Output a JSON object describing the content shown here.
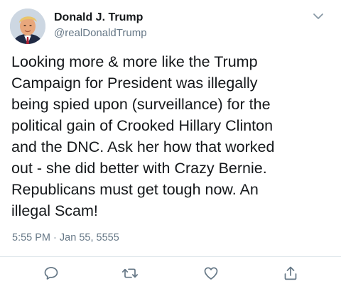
{
  "author": {
    "display_name": "Donald J. Trump",
    "handle": "@realDonaldTrump",
    "avatar_icon": "profile-photo"
  },
  "tweet": {
    "lines": [
      "Looking more & more like the Trump",
      "Campaign for President was illegally",
      "being spied upon (surveillance) for the",
      "political gain of Crooked Hillary Clinton",
      "and the DNC. Ask her how that worked",
      "out - she did better with Crazy Bernie.",
      "Republicans must get tough now. An",
      "illegal Scam!"
    ],
    "time": "5:55 PM",
    "separator": "·",
    "date": "Jan 55, 5555"
  },
  "actions": [
    {
      "name": "reply",
      "icon": "reply-icon"
    },
    {
      "name": "retweet",
      "icon": "retweet-icon"
    },
    {
      "name": "like",
      "icon": "heart-icon"
    },
    {
      "name": "share",
      "icon": "share-icon"
    }
  ],
  "colors": {
    "text": "#14171a",
    "secondary": "#657786",
    "divider": "#e1e8ed",
    "icon": "#657786"
  }
}
